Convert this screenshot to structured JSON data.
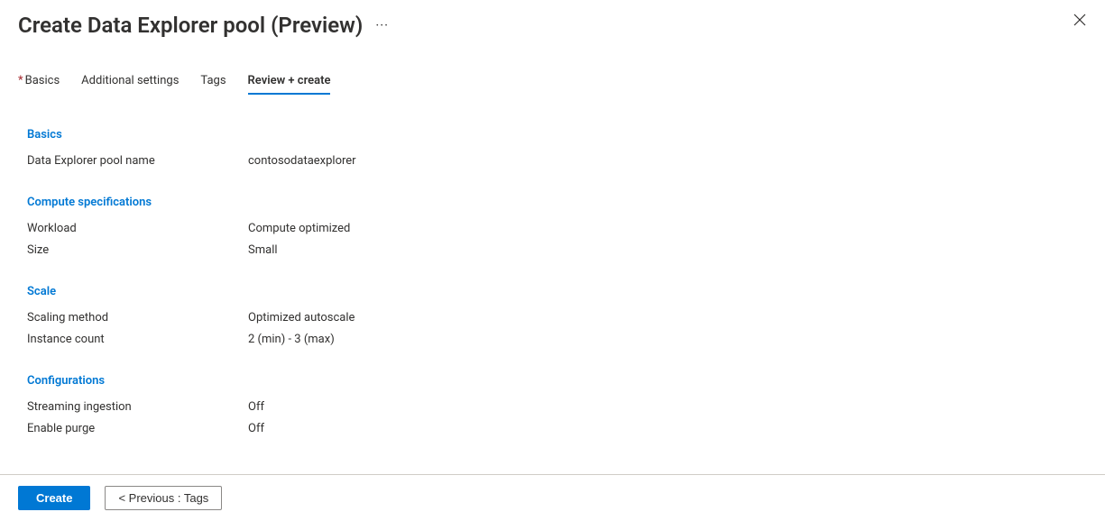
{
  "header": {
    "title": "Create Data Explorer pool (Preview)",
    "more": "···",
    "close": "✕"
  },
  "tabs": {
    "basics_asterisk": "*",
    "basics": "Basics",
    "additional": "Additional settings",
    "tags": "Tags",
    "review": "Review + create"
  },
  "sections": {
    "basics": {
      "heading": "Basics",
      "pool_name_label": "Data Explorer pool name",
      "pool_name_value": "contosodataexplorer"
    },
    "compute": {
      "heading": "Compute specifications",
      "workload_label": "Workload",
      "workload_value": "Compute optimized",
      "size_label": "Size",
      "size_value": "Small"
    },
    "scale": {
      "heading": "Scale",
      "method_label": "Scaling method",
      "method_value": "Optimized autoscale",
      "count_label": "Instance count",
      "count_value": "2 (min) - 3 (max)"
    },
    "config": {
      "heading": "Configurations",
      "streaming_label": "Streaming ingestion",
      "streaming_value": "Off",
      "purge_label": "Enable purge",
      "purge_value": "Off"
    }
  },
  "footer": {
    "create": "Create",
    "previous": "<  Previous : Tags"
  }
}
